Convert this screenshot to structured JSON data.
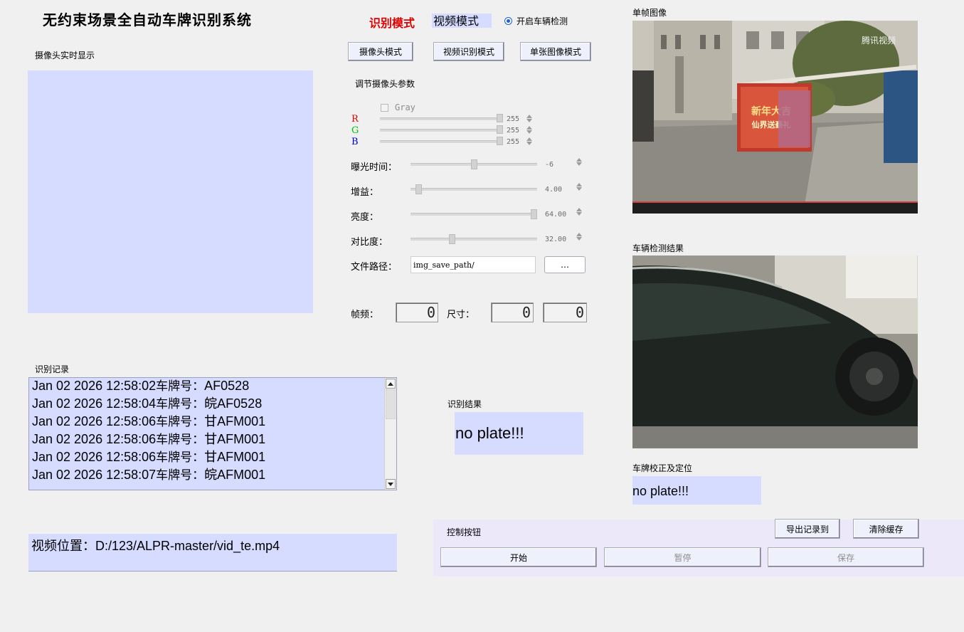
{
  "app": {
    "title": "无约束场景全自动车牌识别系统"
  },
  "mode": {
    "label": "识别模式",
    "current": "视频模式",
    "vehicle_detect_label": "开启车辆检测",
    "vehicle_detect_checked": true
  },
  "mode_buttons": {
    "camera": "摄像头模式",
    "video": "视频识别模式",
    "single": "单张图像模式"
  },
  "camera": {
    "live_label": "摄像头实时显示",
    "params_label": "调节摄像头参数",
    "gray_label": "Gray",
    "rgb": [
      {
        "name": "R",
        "color": "#e00000",
        "value": "255",
        "level": 1.0
      },
      {
        "name": "G",
        "color": "#00c000",
        "value": "255",
        "level": 1.0
      },
      {
        "name": "B",
        "color": "#0000c8",
        "value": "255",
        "level": 1.0
      }
    ],
    "exposure": {
      "label": "曝光时间：",
      "value": "-6",
      "level": 0.5
    },
    "gain": {
      "label": "增益：",
      "value": "4.00",
      "level": 0.04
    },
    "brightness": {
      "label": "亮度：",
      "value": "64.00",
      "level": 1.0
    },
    "contrast": {
      "label": "对比度：",
      "value": "32.00",
      "level": 0.32
    },
    "file_path": {
      "label": "文件路径：",
      "value": "img_save_path/",
      "browse": "…"
    },
    "fps": {
      "label": "帧频：",
      "value": "0"
    },
    "size": {
      "label": "尺寸：",
      "w": "0",
      "h": "0"
    }
  },
  "records": {
    "label": "识别记录",
    "items": [
      {
        "time": "Jan 02 2026 12:58:02",
        "prefix": "车牌号：",
        "plate": "AF0528"
      },
      {
        "time": "Jan 02 2026 12:58:04",
        "prefix": "车牌号：",
        "plate": "皖AF0528"
      },
      {
        "time": "Jan 02 2026 12:58:06",
        "prefix": "车牌号：",
        "plate": "甘AFM001"
      },
      {
        "time": "Jan 02 2026 12:58:06",
        "prefix": "车牌号：",
        "plate": "甘AFM001"
      },
      {
        "time": "Jan 02 2026 12:58:06",
        "prefix": "车牌号：",
        "plate": "甘AFM001"
      },
      {
        "time": "Jan 02 2026 12:58:07",
        "prefix": "车牌号：",
        "plate": "皖AFM001"
      }
    ]
  },
  "video_location": {
    "text": "视频位置：D:/123/ALPR-master/vid_te.mp4"
  },
  "result": {
    "label": "识别结果",
    "value": "no plate!!!"
  },
  "frame": {
    "label": "单帧图像",
    "watermark": "腾讯视频",
    "banner_line1": "新年大吉",
    "banner_line2": "仙界送豪礼"
  },
  "vehicle": {
    "label": "车辆检测结果"
  },
  "plate_locate": {
    "label": "车牌校正及定位",
    "value": "no plate!!!"
  },
  "controls": {
    "label": "控制按钮",
    "export": "导出记录到",
    "clear": "清除缓存",
    "start": "开始",
    "pause": "暂停",
    "save": "保存"
  }
}
